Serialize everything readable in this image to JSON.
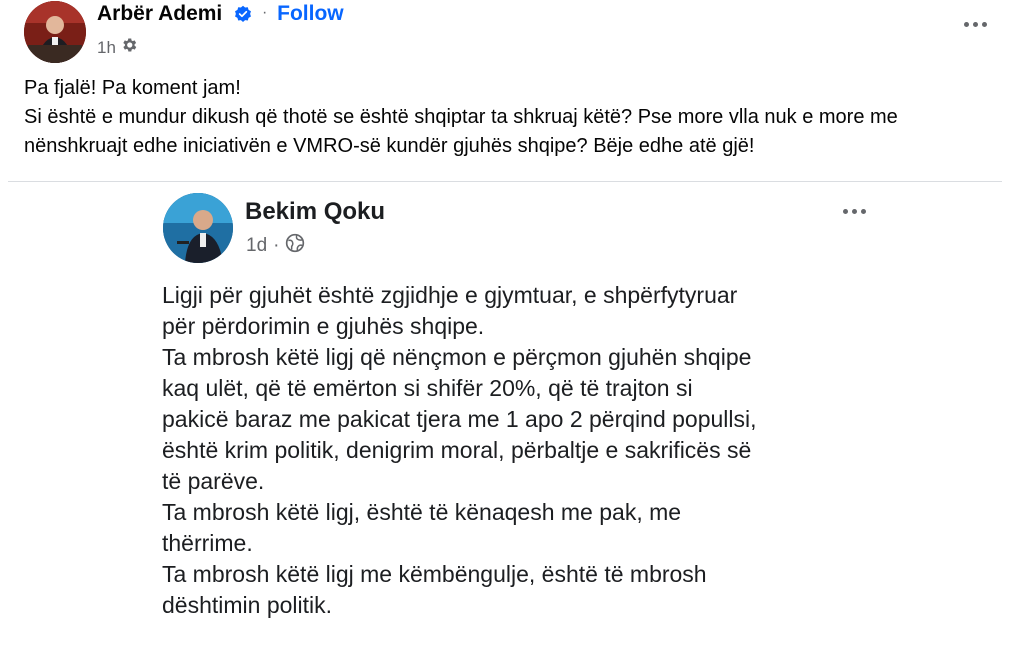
{
  "author": {
    "name": "Arbër Ademi",
    "follow_label": "Follow",
    "separator": "·",
    "time": "1h"
  },
  "post_lines": [
    "Pa fjalë! Pa koment jam!",
    "Si është e mundur dikush që thotë se është shqiptar ta shkruaj këtë? Pse more vlla nuk e more me",
    "nënshkruajt edhe iniciativën e VMRO-së kundër gjuhës shqipe? Bëje edhe atë gjë!"
  ],
  "shared_post": {
    "author": "Bekim Qoku",
    "time": "1d",
    "separator": "·",
    "lines": [
      "Ligji për gjuhët është zgjidhje e gjymtuar, e shpërfytyruar",
      "për përdorimin e gjuhës shqipe.",
      "Ta mbrosh këtë ligj që nënçmon e përçmon gjuhën shqipe",
      "kaq ulët, që të emërton si shifër 20%, që të trajton si",
      "pakicë baraz me pakicat tjera me 1 apo 2 përqind popullsi,",
      "është krim politik, denigrim moral, përbaltje e sakrificës së",
      "të parëve.",
      "Ta mbrosh këtë ligj, është të kënaqesh me pak, me",
      "thërrime.",
      "Ta mbrosh këtë ligj me këmbëngulje, është të mbrosh",
      "dështimin politik."
    ]
  },
  "icons": {
    "verified": "verified-badge-icon",
    "privacy_top": "gear-icon",
    "privacy_shared": "globe-icon",
    "more": "more-horizontal-icon"
  },
  "colors": {
    "accent": "#0866ff",
    "secondary_text": "#65676b",
    "primary_text": "#050505"
  }
}
